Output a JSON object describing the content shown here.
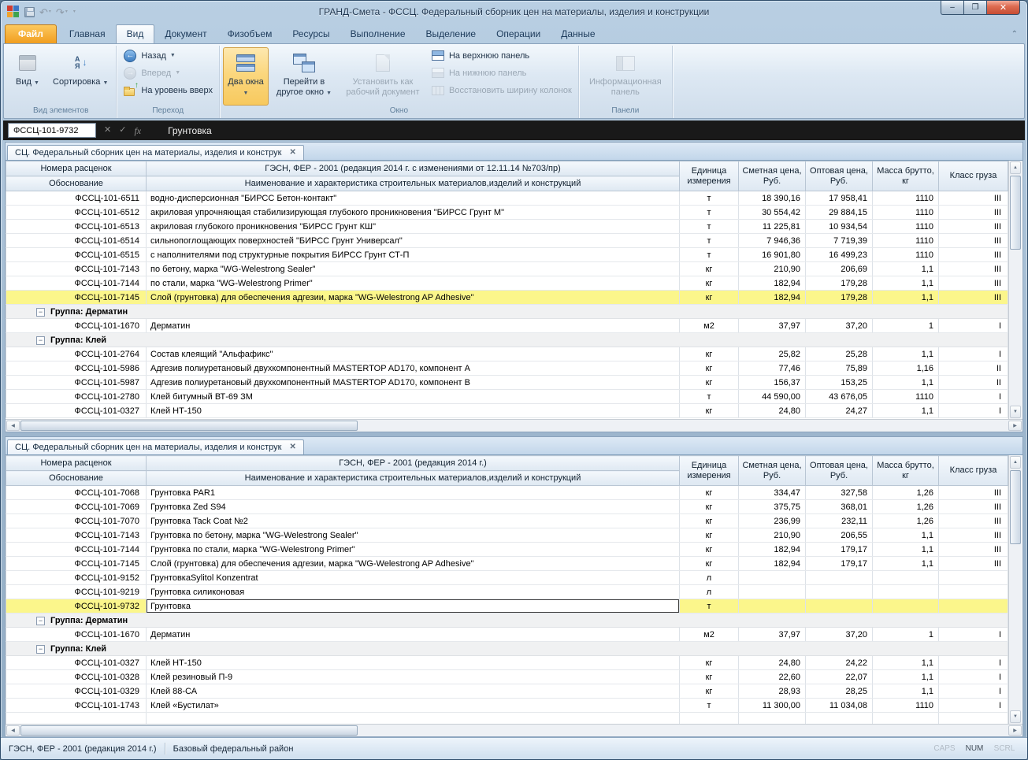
{
  "window": {
    "title": "ГРАНД-Смета - ФССЦ. Федеральный сборник цен на материалы, изделия и конструкции"
  },
  "ribbon": {
    "tabs": [
      {
        "label": "Файл",
        "type": "file"
      },
      {
        "label": "Главная"
      },
      {
        "label": "Вид",
        "active": true
      },
      {
        "label": "Документ"
      },
      {
        "label": "Физобъем"
      },
      {
        "label": "Ресурсы"
      },
      {
        "label": "Выполнение"
      },
      {
        "label": "Выделение"
      },
      {
        "label": "Операции"
      },
      {
        "label": "Данные"
      }
    ],
    "groups": {
      "elements": {
        "label": "Вид элементов",
        "view": "Вид",
        "sort": "Сортировка"
      },
      "navigation": {
        "label": "Переход",
        "back": "Назад",
        "forward": "Вперед",
        "up": "На уровень вверх"
      },
      "window": {
        "label": "Окно",
        "two_windows": "Два окна",
        "goto_other": "Перейти в другое окно",
        "set_working": "Установить как рабочий документ",
        "to_top_panel": "На верхнюю панель",
        "to_bottom_panel": "На нижнюю панель",
        "restore_columns": "Восстановить ширину колонок"
      },
      "panels": {
        "label": "Панели",
        "info_panel": "Информационная панель"
      }
    }
  },
  "formula_bar": {
    "cell_ref": "ФССЦ-101-9732",
    "fx_label": "fx",
    "value": "Грунтовка"
  },
  "panels": [
    {
      "tab": "СЦ. Федеральный сборник цен на материалы, изделия и конструк",
      "header": {
        "col1_top": "Номера расценок",
        "col1_bottom": "Обоснование",
        "col2_top": "ГЭСН, ФЕР - 2001 (редакция 2014 г. с изменениями от 12.11.14 №703/пр)",
        "col2_bottom": "Наименование и характеристика строительных материалов,изделий и конструкций",
        "unit": "Единица измерения",
        "estimate_price": "Сметная цена, Руб.",
        "wholesale_price": "Оптовая цена, Руб.",
        "gross_mass": "Масса брутто, кг",
        "cargo_class": "Класс груза"
      },
      "rows": [
        {
          "type": "item",
          "code": "ФССЦ-101-6511",
          "name": "водно-дисперсионная \"БИРСС Бетон-контакт\"",
          "unit": "т",
          "estimate": "18 390,16",
          "wholesale": "17 958,41",
          "mass": "1110",
          "cls": "III"
        },
        {
          "type": "item",
          "code": "ФССЦ-101-6512",
          "name": "акриловая упрочняющая стабилизирующая глубокого проникновения \"БИРСС Грунт М\"",
          "unit": "т",
          "estimate": "30 554,42",
          "wholesale": "29 884,15",
          "mass": "1110",
          "cls": "III"
        },
        {
          "type": "item",
          "code": "ФССЦ-101-6513",
          "name": "акриловая глубокого проникновения \"БИРСС Грунт КШ\"",
          "unit": "т",
          "estimate": "11 225,81",
          "wholesale": "10 934,54",
          "mass": "1110",
          "cls": "III"
        },
        {
          "type": "item",
          "code": "ФССЦ-101-6514",
          "name": "сильнопоглощающих поверхностей \"БИРСС Грунт Универсал\"",
          "unit": "т",
          "estimate": "7 946,36",
          "wholesale": "7 719,39",
          "mass": "1110",
          "cls": "III"
        },
        {
          "type": "item",
          "code": "ФССЦ-101-6515",
          "name": "с наполнителями под структурные покрытия БИРСС Грунт СТ-П",
          "unit": "т",
          "estimate": "16 901,80",
          "wholesale": "16 499,23",
          "mass": "1110",
          "cls": "III"
        },
        {
          "type": "item",
          "code": "ФССЦ-101-7143",
          "name": "по бетону, марка \"WG-Welestrong Sealer\"",
          "unit": "кг",
          "estimate": "210,90",
          "wholesale": "206,69",
          "mass": "1,1",
          "cls": "III"
        },
        {
          "type": "item",
          "code": "ФССЦ-101-7144",
          "name": "по стали, марка \"WG-Welestrong Primer\"",
          "unit": "кг",
          "estimate": "182,94",
          "wholesale": "179,28",
          "mass": "1,1",
          "cls": "III"
        },
        {
          "type": "item",
          "code": "ФССЦ-101-7145",
          "name": "Слой (грунтовка) для обеспечения адгезии, марка \"WG-Welestrong AP Adhesive\"",
          "unit": "кг",
          "estimate": "182,94",
          "wholesale": "179,28",
          "mass": "1,1",
          "cls": "III",
          "highlight": true
        },
        {
          "type": "group",
          "name": "Группа: Дерматин"
        },
        {
          "type": "item",
          "code": "ФССЦ-101-1670",
          "name": "Дерматин",
          "unit": "м2",
          "estimate": "37,97",
          "wholesale": "37,20",
          "mass": "1",
          "cls": "I"
        },
        {
          "type": "group",
          "name": "Группа: Клей"
        },
        {
          "type": "item",
          "code": "ФССЦ-101-2764",
          "name": "Состав клеящий \"Альфафикс\"",
          "unit": "кг",
          "estimate": "25,82",
          "wholesale": "25,28",
          "mass": "1,1",
          "cls": "I"
        },
        {
          "type": "item",
          "code": "ФССЦ-101-5986",
          "name": "Адгезив полиуретановый двухкомпонентный MASTERTOP AD170, компонент А",
          "unit": "кг",
          "estimate": "77,46",
          "wholesale": "75,89",
          "mass": "1,16",
          "cls": "II"
        },
        {
          "type": "item",
          "code": "ФССЦ-101-5987",
          "name": "Адгезив полиуретановый двухкомпонентный MASTERTOP AD170, компонент В",
          "unit": "кг",
          "estimate": "156,37",
          "wholesale": "153,25",
          "mass": "1,1",
          "cls": "II"
        },
        {
          "type": "item",
          "code": "ФССЦ-101-2780",
          "name": "Клей битумный ВТ-69 ЗМ",
          "unit": "т",
          "estimate": "44 590,00",
          "wholesale": "43 676,05",
          "mass": "1110",
          "cls": "I"
        },
        {
          "type": "item",
          "code": "ФССЦ-101-0327",
          "name": "Клей НТ-150",
          "unit": "кг",
          "estimate": "24,80",
          "wholesale": "24,27",
          "mass": "1,1",
          "cls": "I"
        }
      ]
    },
    {
      "tab": "СЦ. Федеральный сборник цен на материалы, изделия и конструк",
      "header": {
        "col1_top": "Номера расценок",
        "col1_bottom": "Обоснование",
        "col2_top": "ГЭСН, ФЕР - 2001 (редакция 2014 г.)",
        "col2_bottom": "Наименование и характеристика строительных материалов,изделий и конструкций",
        "unit": "Единица измерения",
        "estimate_price": "Сметная цена, Руб.",
        "wholesale_price": "Оптовая цена, Руб.",
        "gross_mass": "Масса брутто, кг",
        "cargo_class": "Класс груза"
      },
      "rows": [
        {
          "type": "item",
          "code": "ФССЦ-101-7068",
          "name": "Грунтовка PAR1",
          "unit": "кг",
          "estimate": "334,47",
          "wholesale": "327,58",
          "mass": "1,26",
          "cls": "III"
        },
        {
          "type": "item",
          "code": "ФССЦ-101-7069",
          "name": "Грунтовка Zed S94",
          "unit": "кг",
          "estimate": "375,75",
          "wholesale": "368,01",
          "mass": "1,26",
          "cls": "III"
        },
        {
          "type": "item",
          "code": "ФССЦ-101-7070",
          "name": "Грунтовка Tack Coat №2",
          "unit": "кг",
          "estimate": "236,99",
          "wholesale": "232,11",
          "mass": "1,26",
          "cls": "III"
        },
        {
          "type": "item",
          "code": "ФССЦ-101-7143",
          "name": "Грунтовка по бетону, марка \"WG-Welestrong Sealer\"",
          "unit": "кг",
          "estimate": "210,90",
          "wholesale": "206,55",
          "mass": "1,1",
          "cls": "III"
        },
        {
          "type": "item",
          "code": "ФССЦ-101-7144",
          "name": "Грунтовка по стали, марка \"WG-Welestrong Primer\"",
          "unit": "кг",
          "estimate": "182,94",
          "wholesale": "179,17",
          "mass": "1,1",
          "cls": "III"
        },
        {
          "type": "item",
          "code": "ФССЦ-101-7145",
          "name": "Слой (грунтовка) для обеспечения адгезии, марка \"WG-Welestrong AP Adhesive\"",
          "unit": "кг",
          "estimate": "182,94",
          "wholesale": "179,17",
          "mass": "1,1",
          "cls": "III"
        },
        {
          "type": "item",
          "code": "ФССЦ-101-9152",
          "name": "ГрунтовкаSylitol Konzentrat",
          "unit": "л",
          "estimate": "",
          "wholesale": "",
          "mass": "",
          "cls": ""
        },
        {
          "type": "item",
          "code": "ФССЦ-101-9219",
          "name": "Грунтовка силиконовая",
          "unit": "л",
          "estimate": "",
          "wholesale": "",
          "mass": "",
          "cls": ""
        },
        {
          "type": "item",
          "code": "ФССЦ-101-9732",
          "name": "Грунтовка",
          "unit": "т",
          "estimate": "",
          "wholesale": "",
          "mass": "",
          "cls": "",
          "highlight": true,
          "selected": true
        },
        {
          "type": "group",
          "name": "Группа: Дерматин"
        },
        {
          "type": "item",
          "code": "ФССЦ-101-1670",
          "name": "Дерматин",
          "unit": "м2",
          "estimate": "37,97",
          "wholesale": "37,20",
          "mass": "1",
          "cls": "I"
        },
        {
          "type": "group",
          "name": "Группа: Клей"
        },
        {
          "type": "item",
          "code": "ФССЦ-101-0327",
          "name": "Клей НТ-150",
          "unit": "кг",
          "estimate": "24,80",
          "wholesale": "24,22",
          "mass": "1,1",
          "cls": "I"
        },
        {
          "type": "item",
          "code": "ФССЦ-101-0328",
          "name": "Клей резиновый П-9",
          "unit": "кг",
          "estimate": "22,60",
          "wholesale": "22,07",
          "mass": "1,1",
          "cls": "I"
        },
        {
          "type": "item",
          "code": "ФССЦ-101-0329",
          "name": "Клей 88-СА",
          "unit": "кг",
          "estimate": "28,93",
          "wholesale": "28,25",
          "mass": "1,1",
          "cls": "I"
        },
        {
          "type": "item",
          "code": "ФССЦ-101-1743",
          "name": "Клей «Бустилат»",
          "unit": "т",
          "estimate": "11 300,00",
          "wholesale": "11 034,08",
          "mass": "1110",
          "cls": "I"
        },
        {
          "type": "item",
          "code": "",
          "name": "",
          "unit": "",
          "estimate": "",
          "wholesale": "",
          "mass": "",
          "cls": "",
          "partial": true
        }
      ]
    }
  ],
  "status_bar": {
    "database": "ГЭСН, ФЕР - 2001 (редакция 2014 г.)",
    "region": "Базовый федеральный район",
    "caps": "CAPS",
    "num": "NUM",
    "scrl": "SCRL"
  }
}
